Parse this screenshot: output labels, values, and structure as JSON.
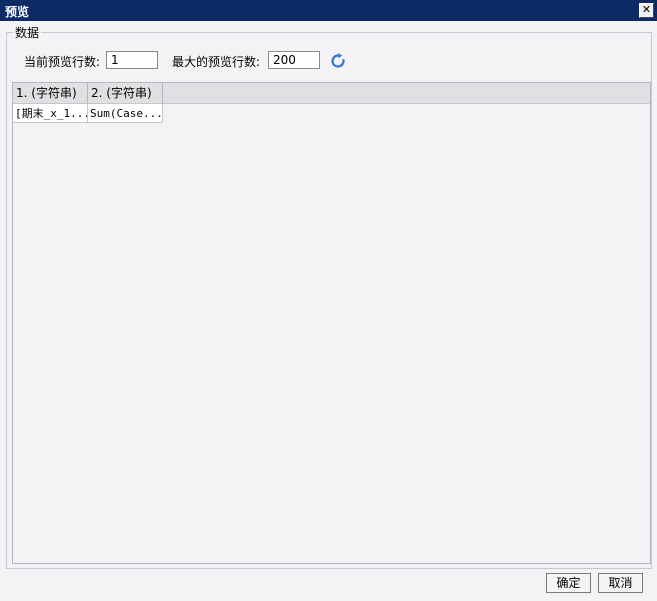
{
  "window": {
    "title": "预览",
    "close_glyph": "✕"
  },
  "group": {
    "legend": "数据"
  },
  "controls": {
    "current_rows_label": "当前预览行数:",
    "current_rows_value": "1",
    "max_rows_label": "最大的预览行数:",
    "max_rows_value": "200",
    "refresh_icon": "refresh-icon"
  },
  "grid": {
    "columns": [
      "1. (字符串)",
      "2. (字符串)"
    ],
    "rows": [
      [
        "[期末_x_1...",
        "Sum(Case..."
      ]
    ]
  },
  "footer": {
    "ok_label": "确定",
    "cancel_label": "取消"
  },
  "colors": {
    "titlebar": "#0d2a67",
    "refresh": "#2b7bd6"
  }
}
